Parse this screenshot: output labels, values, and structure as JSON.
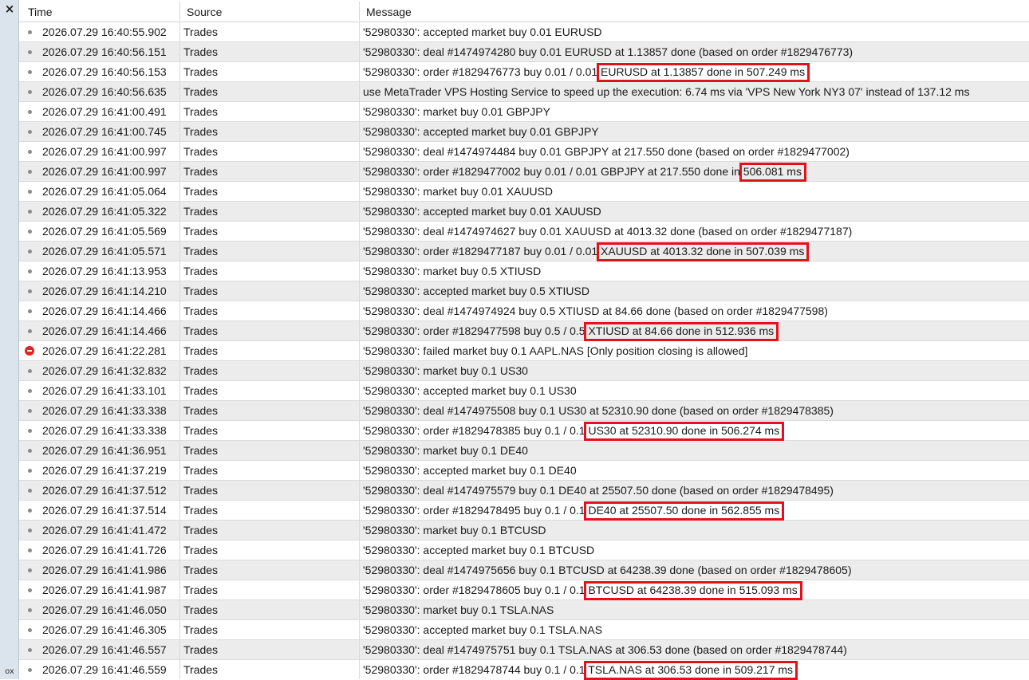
{
  "panel": {
    "close_glyph": "×",
    "side_label": "ox"
  },
  "columns": [
    "Time",
    "Source",
    "Message"
  ],
  "highlight_color": "#e3111b",
  "rows": [
    {
      "icon": "dot",
      "time": "2026.07.29 16:40:55.902",
      "source": "Trades",
      "message": "'52980330': accepted market buy 0.01 EURUSD"
    },
    {
      "icon": "dot",
      "time": "2026.07.29 16:40:56.151",
      "source": "Trades",
      "message": "'52980330': deal #1474974280 buy 0.01 EURUSD at 1.13857 done (based on order #1829476773)"
    },
    {
      "icon": "dot",
      "time": "2026.07.29 16:40:56.153",
      "source": "Trades",
      "message": "'52980330': order #1829476773 buy 0.01 / 0.01 EURUSD at 1.13857 done in 507.249 ms"
    },
    {
      "icon": "dot",
      "time": "2026.07.29 16:40:56.635",
      "source": "Trades",
      "message": "use MetaTrader VPS Hosting Service to speed up the execution: 6.74 ms via 'VPS New York NY3 07' instead of 137.12 ms"
    },
    {
      "icon": "dot",
      "time": "2026.07.29 16:41:00.491",
      "source": "Trades",
      "message": "'52980330': market buy 0.01 GBPJPY"
    },
    {
      "icon": "dot",
      "time": "2026.07.29 16:41:00.745",
      "source": "Trades",
      "message": "'52980330': accepted market buy 0.01 GBPJPY"
    },
    {
      "icon": "dot",
      "time": "2026.07.29 16:41:00.997",
      "source": "Trades",
      "message": "'52980330': deal #1474974484 buy 0.01 GBPJPY at 217.550 done (based on order #1829477002)"
    },
    {
      "icon": "dot",
      "time": "2026.07.29 16:41:00.997",
      "source": "Trades",
      "message": "'52980330': order #1829477002 buy 0.01 / 0.01 GBPJPY at 217.550 done in 506.081 ms"
    },
    {
      "icon": "dot",
      "time": "2026.07.29 16:41:05.064",
      "source": "Trades",
      "message": "'52980330': market buy 0.01 XAUUSD"
    },
    {
      "icon": "dot",
      "time": "2026.07.29 16:41:05.322",
      "source": "Trades",
      "message": "'52980330': accepted market buy 0.01 XAUUSD"
    },
    {
      "icon": "dot",
      "time": "2026.07.29 16:41:05.569",
      "source": "Trades",
      "message": "'52980330': deal #1474974627 buy 0.01 XAUUSD at 4013.32 done (based on order #1829477187)"
    },
    {
      "icon": "dot",
      "time": "2026.07.29 16:41:05.571",
      "source": "Trades",
      "message": "'52980330': order #1829477187 buy 0.01 / 0.01 XAUUSD at 4013.32 done in 507.039 ms"
    },
    {
      "icon": "dot",
      "time": "2026.07.29 16:41:13.953",
      "source": "Trades",
      "message": "'52980330': market buy 0.5 XTIUSD"
    },
    {
      "icon": "dot",
      "time": "2026.07.29 16:41:14.210",
      "source": "Trades",
      "message": "'52980330': accepted market buy 0.5 XTIUSD"
    },
    {
      "icon": "dot",
      "time": "2026.07.29 16:41:14.466",
      "source": "Trades",
      "message": "'52980330': deal #1474974924 buy 0.5 XTIUSD at 84.66 done (based on order #1829477598)"
    },
    {
      "icon": "dot",
      "time": "2026.07.29 16:41:14.466",
      "source": "Trades",
      "message": "'52980330': order #1829477598 buy 0.5 / 0.5 XTIUSD at 84.66 done in 512.936 ms"
    },
    {
      "icon": "error",
      "time": "2026.07.29 16:41:22.281",
      "source": "Trades",
      "message": "'52980330': failed market buy 0.1 AAPL.NAS [Only position closing is allowed]"
    },
    {
      "icon": "dot",
      "time": "2026.07.29 16:41:32.832",
      "source": "Trades",
      "message": "'52980330': market buy 0.1 US30"
    },
    {
      "icon": "dot",
      "time": "2026.07.29 16:41:33.101",
      "source": "Trades",
      "message": "'52980330': accepted market buy 0.1 US30"
    },
    {
      "icon": "dot",
      "time": "2026.07.29 16:41:33.338",
      "source": "Trades",
      "message": "'52980330': deal #1474975508 buy 0.1 US30 at 52310.90 done (based on order #1829478385)"
    },
    {
      "icon": "dot",
      "time": "2026.07.29 16:41:33.338",
      "source": "Trades",
      "message": "'52980330': order #1829478385 buy 0.1 / 0.1 US30 at 52310.90 done in 506.274 ms"
    },
    {
      "icon": "dot",
      "time": "2026.07.29 16:41:36.951",
      "source": "Trades",
      "message": "'52980330': market buy 0.1 DE40"
    },
    {
      "icon": "dot",
      "time": "2026.07.29 16:41:37.219",
      "source": "Trades",
      "message": "'52980330': accepted market buy 0.1 DE40"
    },
    {
      "icon": "dot",
      "time": "2026.07.29 16:41:37.512",
      "source": "Trades",
      "message": "'52980330': deal #1474975579 buy 0.1 DE40 at 25507.50 done (based on order #1829478495)"
    },
    {
      "icon": "dot",
      "time": "2026.07.29 16:41:37.514",
      "source": "Trades",
      "message": "'52980330': order #1829478495 buy 0.1 / 0.1 DE40 at 25507.50 done in 562.855 ms"
    },
    {
      "icon": "dot",
      "time": "2026.07.29 16:41:41.472",
      "source": "Trades",
      "message": "'52980330': market buy 0.1 BTCUSD"
    },
    {
      "icon": "dot",
      "time": "2026.07.29 16:41:41.726",
      "source": "Trades",
      "message": "'52980330': accepted market buy 0.1 BTCUSD"
    },
    {
      "icon": "dot",
      "time": "2026.07.29 16:41:41.986",
      "source": "Trades",
      "message": "'52980330': deal #1474975656 buy 0.1 BTCUSD at 64238.39 done (based on order #1829478605)"
    },
    {
      "icon": "dot",
      "time": "2026.07.29 16:41:41.987",
      "source": "Trades",
      "message": "'52980330': order #1829478605 buy 0.1 / 0.1 BTCUSD at 64238.39 done in 515.093 ms"
    },
    {
      "icon": "dot",
      "time": "2026.07.29 16:41:46.050",
      "source": "Trades",
      "message": "'52980330': market buy 0.1 TSLA.NAS"
    },
    {
      "icon": "dot",
      "time": "2026.07.29 16:41:46.305",
      "source": "Trades",
      "message": "'52980330': accepted market buy 0.1 TSLA.NAS"
    },
    {
      "icon": "dot",
      "time": "2026.07.29 16:41:46.557",
      "source": "Trades",
      "message": "'52980330': deal #1474975751 buy 0.1 TSLA.NAS at 306.53 done (based on order #1829478744)"
    },
    {
      "icon": "dot",
      "time": "2026.07.29 16:41:46.559",
      "source": "Trades",
      "message": "'52980330': order #1829478744 buy 0.1 / 0.1 TSLA.NAS at 306.53 done in 509.217 ms"
    }
  ]
}
